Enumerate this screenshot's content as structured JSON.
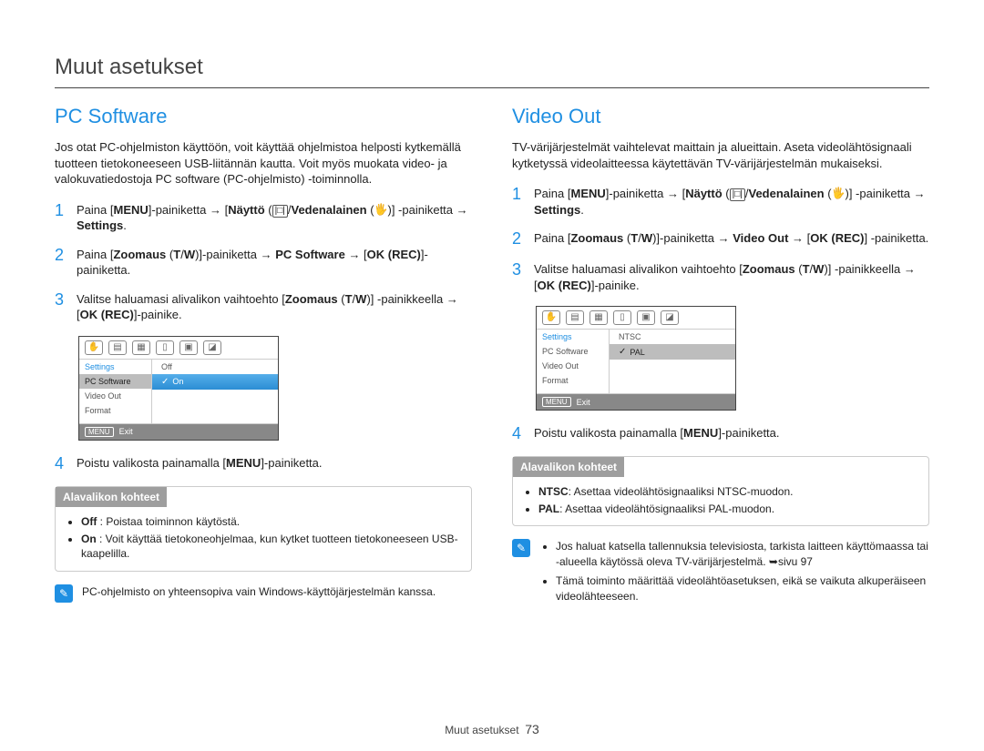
{
  "page": {
    "title": "Muut asetukset",
    "footer_label": "Muut asetukset",
    "page_number": "73"
  },
  "left": {
    "heading": "PC Software",
    "intro": "Jos otat PC-ohjelmiston käyttöön, voit käyttää ohjelmistoa helposti kytkemällä tuotteen tietokoneeseen USB-liitännän kautta. Voit myös muokata video- ja valokuvatiedostoja PC software (PC-ohjelmisto) -toiminnolla.",
    "steps": {
      "s1": {
        "num": "1",
        "p1": "Paina [",
        "b1": "MENU",
        "p2": "]-painiketta → [",
        "b2": "Näyttö",
        "p3": " (",
        "p4": "/",
        "b3": "Vedenalainen",
        "p5": " (",
        "p6": ")] -painiketta → ",
        "b4": "Settings",
        "p7": "."
      },
      "s2": {
        "num": "2",
        "p1": "Paina [",
        "b1": "Zoomaus",
        "p2": " (",
        "b2": "T",
        "p3": "/",
        "b3": "W",
        "p4": ")]-painiketta → ",
        "b4": "PC Software",
        "p5": " → [",
        "b5": "OK (REC)",
        "p6": "]-painiketta."
      },
      "s3": {
        "num": "3",
        "p1": "Valitse haluamasi alivalikon vaihtoehto [",
        "b1": "Zoomaus",
        "p2": " (",
        "b2": "T",
        "p3": "/",
        "b3": "W",
        "p4": ")] -painikkeella → [",
        "b4": "OK (REC)",
        "p5": "]-painike."
      },
      "s4": {
        "num": "4",
        "p1": "Poistu valikosta painamalla [",
        "b1": "MENU",
        "p2": "]-painiketta."
      }
    },
    "screen": {
      "settings_label": "Settings",
      "left_items": [
        "PC Software",
        "Video Out",
        "Format"
      ],
      "left_active_index": 0,
      "right_items": [
        "Off",
        "On"
      ],
      "right_active_index": 1,
      "exit_label": "Exit",
      "exit_btn": "MENU"
    },
    "submenu": {
      "header": "Alavalikon kohteet",
      "items": [
        {
          "label": "Off",
          "desc": ": Poistaa toiminnon käytöstä."
        },
        {
          "label": "On",
          "desc": ": Voit käyttää tietokoneohjelmaa, kun kytket tuotteen tietokoneeseen USB-kaapelilla."
        }
      ]
    },
    "note": "PC-ohjelmisto on yhteensopiva vain Windows-käyttöjärjestelmän kanssa."
  },
  "right": {
    "heading": "Video Out",
    "intro": "TV-värijärjestelmät vaihtelevat maittain ja alueittain. Aseta videolähtösignaali kytketyssä videolaitteessa käytettävän TV-värijärjestelmän mukaiseksi.",
    "steps": {
      "s1": {
        "num": "1",
        "p1": "Paina [",
        "b1": "MENU",
        "p2": "]-painiketta → [",
        "b2": "Näyttö",
        "p3": " (",
        "p4": "/",
        "b3": "Vedenalainen",
        "p5": " (",
        "p6": ")] -painiketta → ",
        "b4": "Settings",
        "p7": "."
      },
      "s2": {
        "num": "2",
        "p1": "Paina [",
        "b1": "Zoomaus",
        "p2": " (",
        "b2": "T",
        "p3": "/",
        "b3": "W",
        "p4": ")]-painiketta → ",
        "b4": "Video Out",
        "p5": " → [",
        "b5": "OK (REC)",
        "p6": "] -painiketta."
      },
      "s3": {
        "num": "3",
        "p1": "Valitse haluamasi alivalikon vaihtoehto [",
        "b1": "Zoomaus",
        "p2": " (",
        "b2": "T",
        "p3": "/",
        "b3": "W",
        "p4": ")] -painikkeella → [",
        "b4": "OK (REC)",
        "p5": "]-painike."
      },
      "s4": {
        "num": "4",
        "p1": "Poistu valikosta painamalla [",
        "b1": "MENU",
        "p2": "]-painiketta."
      }
    },
    "screen": {
      "settings_label": "Settings",
      "left_items": [
        "PC Software",
        "Video Out",
        "Format"
      ],
      "left_active_index": 1,
      "right_items": [
        "NTSC",
        "PAL"
      ],
      "right_active_index": 1,
      "exit_label": "Exit",
      "exit_btn": "MENU"
    },
    "submenu": {
      "header": "Alavalikon kohteet",
      "items": [
        {
          "label": "NTSC",
          "desc": ": Asettaa videolähtösignaaliksi NTSC-muodon."
        },
        {
          "label": "PAL",
          "desc": ": Asettaa videolähtösignaaliksi PAL-muodon."
        }
      ]
    },
    "notes": [
      "Jos haluat katsella tallennuksia televisiosta, tarkista laitteen käyttömaassa tai -alueella käytössä oleva TV-värijärjestelmä. ➥sivu 97",
      "Tämä toiminto määrittää videolähtöasetuksen, eikä se vaikuta alkuperäiseen videolähteeseen."
    ]
  }
}
